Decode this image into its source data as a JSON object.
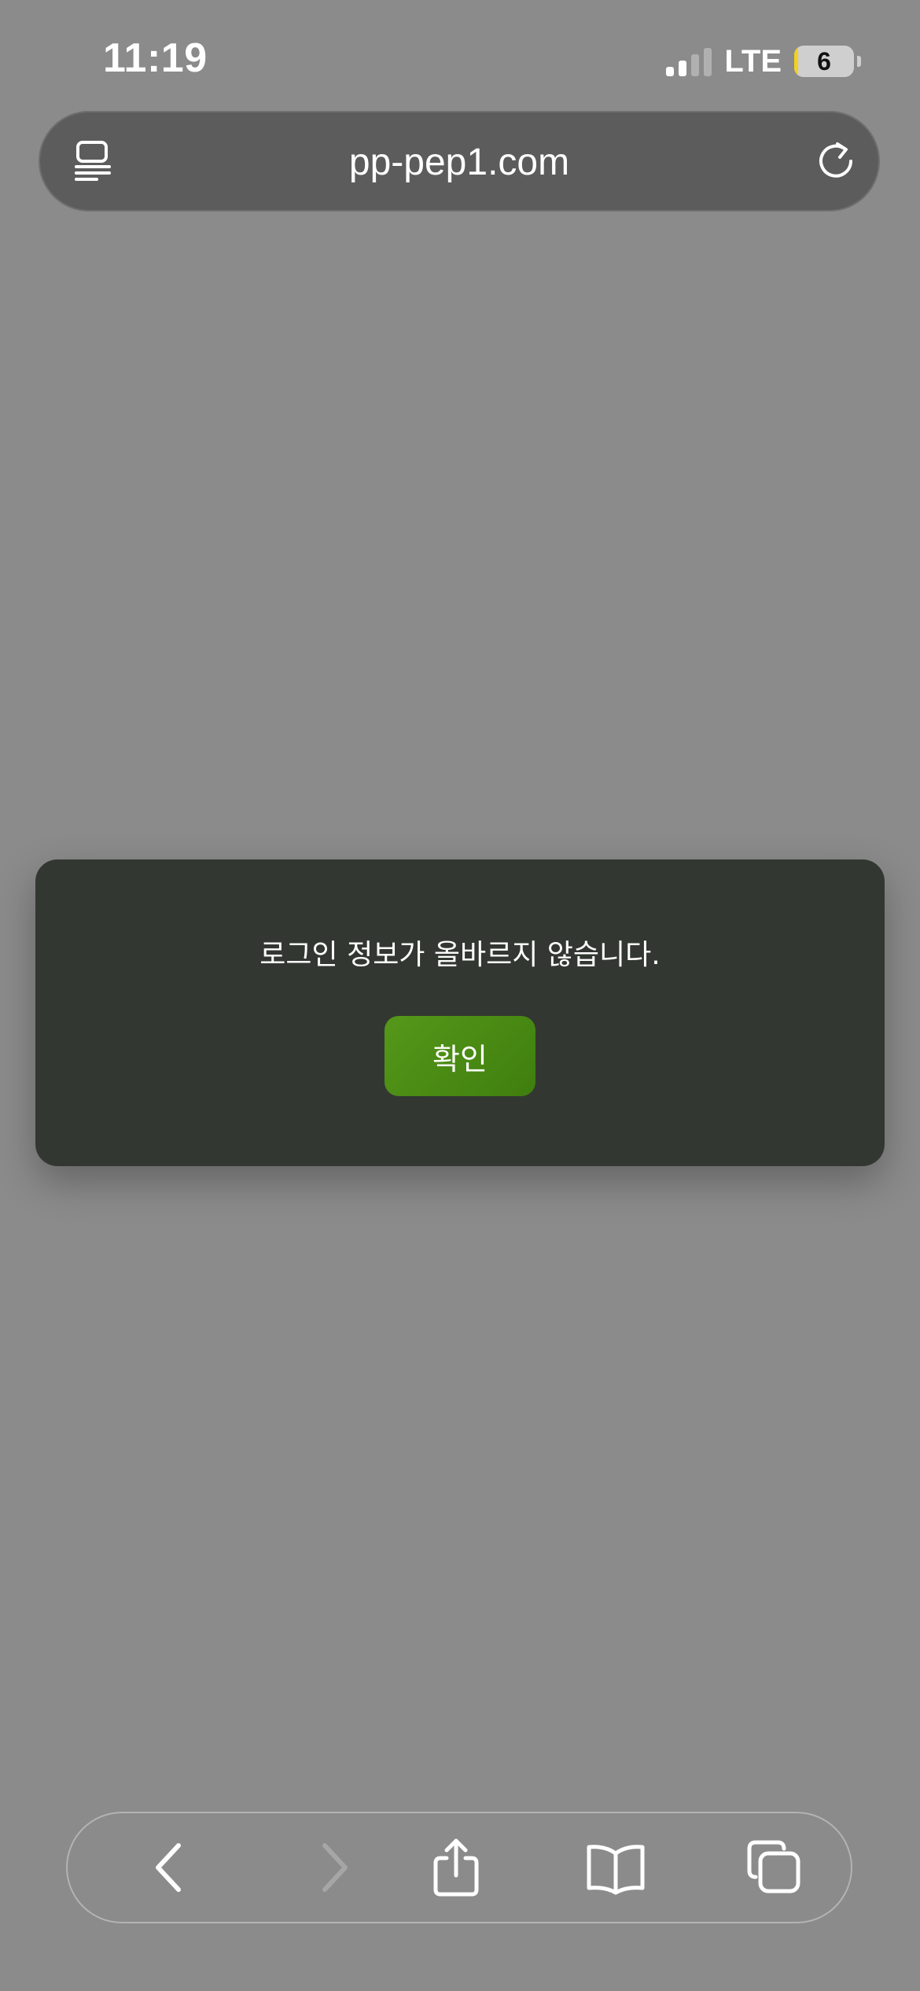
{
  "status_bar": {
    "time": "11:19",
    "network": "LTE",
    "battery_level": "6",
    "signal_bars_active": 2,
    "signal_bars_total": 4,
    "battery_fill_fraction": 0.06
  },
  "browser": {
    "url": "pp-pep1.com",
    "reader_icon": "reader-mode-icon",
    "reload_icon": "reload-icon"
  },
  "dialog": {
    "message": "로그인 정보가 올바르지 않습니다.",
    "confirm_label": "확인",
    "confirm_color": "#4a8a14"
  },
  "toolbar": {
    "back_icon": "chevron-left-icon",
    "forward_icon": "chevron-right-icon",
    "share_icon": "share-icon",
    "bookmarks_icon": "book-icon",
    "tabs_icon": "tabs-icon"
  },
  "colors": {
    "background": "#8b8b8b",
    "url_bar": "#5c5c5c",
    "dialog": "#323831",
    "battery_fill": "#f2d21a"
  }
}
